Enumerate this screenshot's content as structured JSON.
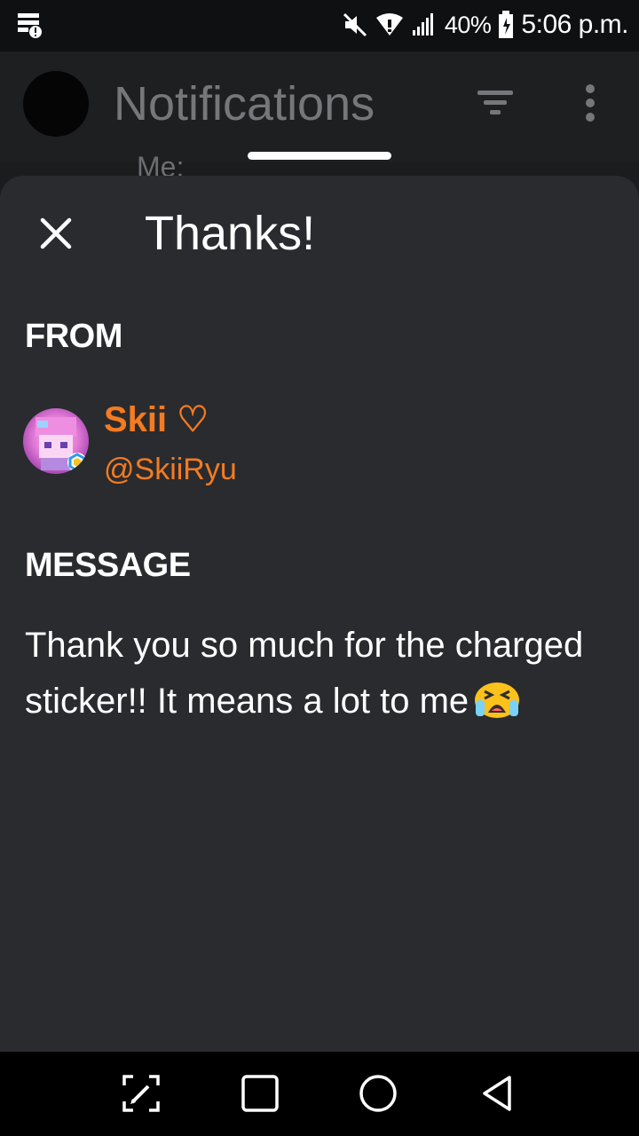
{
  "status_bar": {
    "battery_percent": "40%",
    "time": "5:06 p.m."
  },
  "app_header": {
    "title": "Notifications",
    "behind_text": "Me:"
  },
  "sheet": {
    "title": "Thanks!",
    "from_label": "FROM",
    "user": {
      "display_name": "Skii ♡",
      "handle": "@SkiiRyu"
    },
    "message_label": "MESSAGE",
    "message_text": "Thank you so much for the charged sticker!! It means a lot to me"
  },
  "icons": {
    "close": "close-icon",
    "filter": "filter-icon",
    "more": "more-vertical-icon",
    "emoji": "crying-face-emoji"
  },
  "colors": {
    "accent": "#f47b20",
    "sheet_bg": "#292b2f"
  }
}
